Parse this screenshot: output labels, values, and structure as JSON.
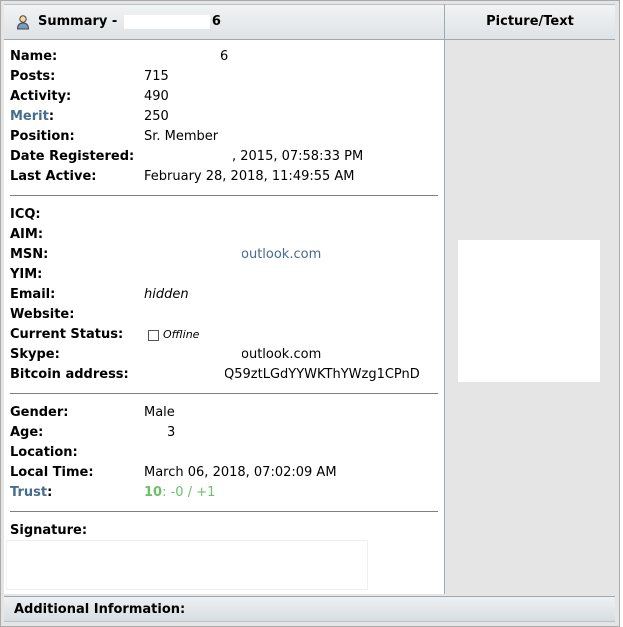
{
  "header": {
    "summary_prefix": "Summary -",
    "summary_suffix": "6",
    "picture_text": "Picture/Text"
  },
  "info": {
    "name": {
      "label": "Name:",
      "value": "6"
    },
    "posts": {
      "label": "Posts:",
      "value": "715"
    },
    "activity": {
      "label": "Activity:",
      "value": "490"
    },
    "merit": {
      "label": "Merit",
      "colon": ":",
      "value": "250"
    },
    "position": {
      "label": "Position:",
      "value": "Sr. Member"
    },
    "date_registered": {
      "label": "Date Registered:",
      "value": ", 2015, 07:58:33 PM"
    },
    "last_active": {
      "label": "Last Active:",
      "value": "February 28, 2018, 11:49:55 AM"
    }
  },
  "contact": {
    "icq": {
      "label": "ICQ:"
    },
    "aim": {
      "label": "AIM:"
    },
    "msn": {
      "label": "MSN:",
      "value": "outlook.com"
    },
    "yim": {
      "label": "YIM:"
    },
    "email": {
      "label": "Email:",
      "value": "hidden"
    },
    "website": {
      "label": "Website:"
    },
    "status": {
      "label": "Current Status:",
      "value": "Offline"
    },
    "skype": {
      "label": "Skype:",
      "value": "outlook.com"
    },
    "bitcoin": {
      "label": "Bitcoin address:",
      "value": "Q59ztLGdYYWKThYWzg1CPnD"
    }
  },
  "personal": {
    "gender": {
      "label": "Gender:",
      "value": "Male"
    },
    "age": {
      "label": "Age:",
      "value": "3"
    },
    "location": {
      "label": "Location:"
    },
    "local_time": {
      "label": "Local Time:",
      "value": "March 06, 2018, 07:02:09 AM"
    },
    "trust": {
      "label": "Trust",
      "colon": ":",
      "score": "10",
      "detail": ": -0 / +1"
    }
  },
  "signature": {
    "label": "Signature:"
  },
  "footer": {
    "title": "Additional Information:"
  },
  "colors": {
    "link_blue": "#476c8e",
    "trust_green": "#6bc068",
    "header_border": "#9eaab3"
  }
}
